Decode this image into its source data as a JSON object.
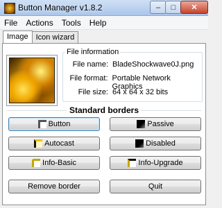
{
  "window": {
    "title": "Button Manager v1.8.2",
    "minimize_glyph": "–",
    "maximize_glyph": "□",
    "close_glyph": "✕"
  },
  "menu": {
    "items": [
      "File",
      "Actions",
      "Tools",
      "Help"
    ]
  },
  "tabs": [
    {
      "label": "Image",
      "active": true
    },
    {
      "label": "Icon wizard",
      "active": false
    }
  ],
  "file_info": {
    "legend": "File information",
    "rows": [
      {
        "label": "File name:",
        "value": "BladeShockwave0J.png"
      },
      {
        "label": "File format:",
        "value": "Portable Network Graphics"
      },
      {
        "label": "File size:",
        "value": "64 x 64 x 32 bits"
      }
    ]
  },
  "standard_borders": {
    "legend": "Standard borders",
    "buttons": [
      {
        "label": "Button",
        "icon": "button-border-icon"
      },
      {
        "label": "Passive",
        "icon": "passive-border-icon"
      },
      {
        "label": "Autocast",
        "icon": "autocast-border-icon"
      },
      {
        "label": "Disabled",
        "icon": "disabled-border-icon"
      },
      {
        "label": "Info-Basic",
        "icon": "info-basic-border-icon"
      },
      {
        "label": "Info-Upgrade",
        "icon": "info-upgrade-border-icon"
      }
    ]
  },
  "actions": {
    "remove_border": "Remove border",
    "quit": "Quit"
  },
  "colors": {
    "titlebar": "#aac6ea",
    "close_button": "#c7432d",
    "focus_border": "#3c7fb1"
  }
}
